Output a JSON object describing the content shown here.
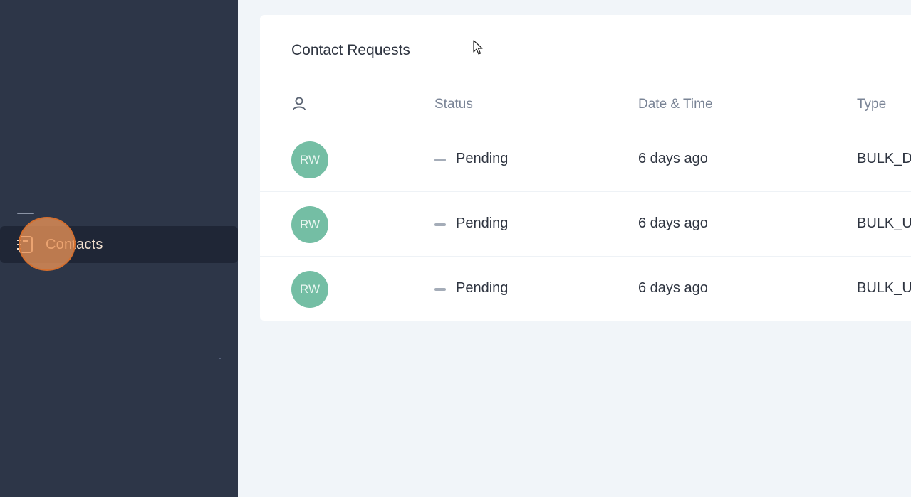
{
  "sidebar": {
    "nav_items": [
      {
        "label": "Contacts",
        "icon": "contacts-book-icon",
        "active": true
      }
    ]
  },
  "main": {
    "card_title": "Contact Requests",
    "columns": {
      "user_icon": "user-icon",
      "status": "Status",
      "date_time": "Date & Time",
      "type": "Type"
    },
    "rows": [
      {
        "initials": "RW",
        "status": "Pending",
        "date": "6 days ago",
        "type": "BULK_D"
      },
      {
        "initials": "RW",
        "status": "Pending",
        "date": "6 days ago",
        "type": "BULK_U"
      },
      {
        "initials": "RW",
        "status": "Pending",
        "date": "6 days ago",
        "type": "BULK_U"
      }
    ]
  },
  "colors": {
    "sidebar_bg": "#2d3648",
    "active_nav_bg": "#1f2636",
    "avatar": "#74bea4",
    "click_indicator": "#e99256",
    "page_bg": "#f1f5f9"
  }
}
